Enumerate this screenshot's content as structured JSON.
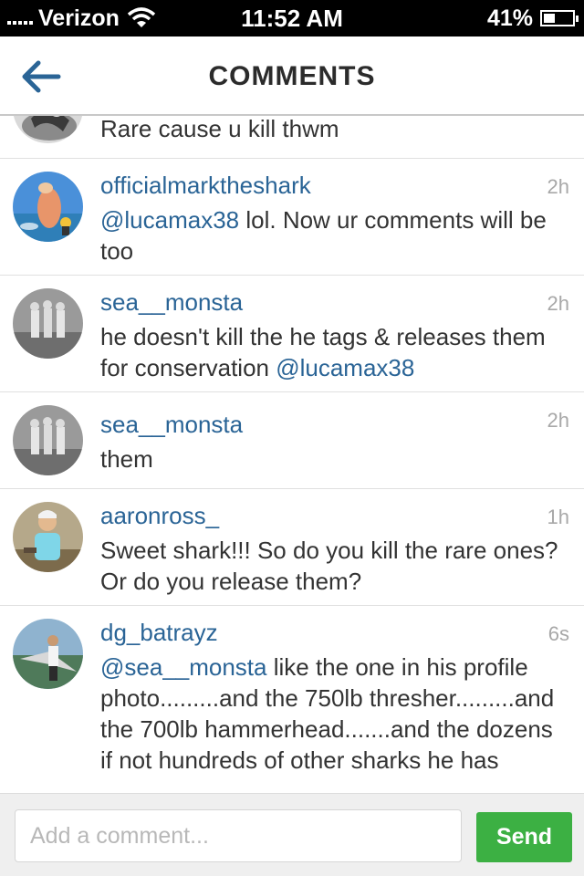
{
  "status_bar": {
    "carrier": "Verizon",
    "time": "11:52 AM",
    "battery": "41%",
    "battery_level": 0.41
  },
  "header": {
    "title": "COMMENTS",
    "back_icon": "back-arrow-icon"
  },
  "comments": [
    {
      "username": "",
      "time": "",
      "text": "Rare cause u kill thwm",
      "mention": ""
    },
    {
      "username": "officialmarktheshark",
      "time": "2h",
      "mention": "@lucamax38",
      "text": " lol. Now ur comments will be too"
    },
    {
      "username": "sea__monsta",
      "time": "2h",
      "text": "he doesn't kill the he tags & releases them for conservation ",
      "mention": "@lucamax38"
    },
    {
      "username": "sea__monsta",
      "time": "2h",
      "text": "them",
      "mention": ""
    },
    {
      "username": "aaronross_",
      "time": "1h",
      "text": "Sweet shark!!! So do you kill the rare ones? Or do you release them?",
      "mention": ""
    },
    {
      "username": "dg_batrayz",
      "time": "6s",
      "mention": "@sea__monsta",
      "text": " like the one in his profile photo.........and the 750lb thresher.........and the 700lb hammerhead.......and the dozens if not hundreds of other sharks he has"
    }
  ],
  "input_bar": {
    "placeholder": "Add a comment...",
    "send_label": "Send"
  },
  "colors": {
    "link": "#2a6496",
    "send": "#3cb043",
    "status_bar": "#000000"
  }
}
